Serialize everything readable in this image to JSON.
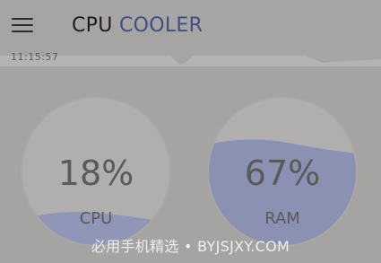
{
  "app": {
    "title_part1": "CPU",
    "title_part2": "COOLER",
    "title_color": "#3f4f84"
  },
  "status": {
    "time": "11:15:57"
  },
  "gauges": [
    {
      "label": "CPU",
      "percent_text": "18%",
      "value": 0.18
    },
    {
      "label": "RAM",
      "percent_text": "67%",
      "value": 0.67
    }
  ],
  "watermark": "必用手机精选 • BYJSJXY.COM",
  "icons": {
    "menu": "menu-icon"
  }
}
